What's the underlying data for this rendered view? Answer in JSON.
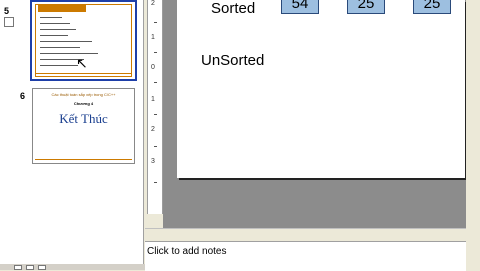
{
  "thumbnails": [
    {
      "number": "5"
    },
    {
      "number": "6",
      "header": "Các thuật toán sắp xếp trong C/C++",
      "subtitle": "Chương 4",
      "title": "Kết Thúc"
    }
  ],
  "ruler": {
    "marks": [
      "2",
      "1",
      "0",
      "1",
      "2",
      "3"
    ]
  },
  "slide": {
    "sorted_label": "Sorted",
    "unsorted_label": "UnSorted",
    "cells": [
      "54",
      "25",
      "25"
    ]
  },
  "notes": {
    "placeholder": "Click to add notes"
  }
}
